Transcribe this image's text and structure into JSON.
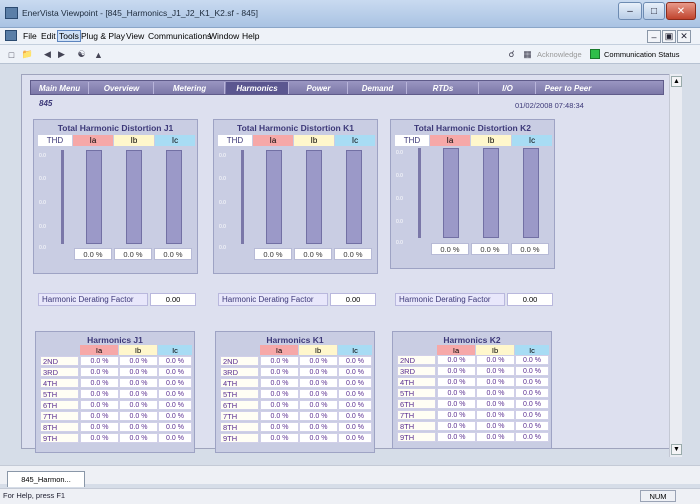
{
  "window": {
    "title": "EnerVista Viewpoint - [845_Harmonics_J1_J2_K1_K2.sf - 845]"
  },
  "menu": [
    "File",
    "Edit",
    "Tools",
    "Plug & Play",
    "View",
    "Communications",
    "Window",
    "Help"
  ],
  "toolbar": {
    "acknowledge": "Acknowledge",
    "comm_status": "Communication Status"
  },
  "nav": [
    "Main Menu",
    "Overview",
    "Metering",
    "Harmonics",
    "Power",
    "Demand",
    "RTDs",
    "I/O",
    "Peer to Peer"
  ],
  "device": "845",
  "datetime": "01/02/2008 07:48:34",
  "thd_panels": [
    {
      "title": "Total Harmonic Distortion J1",
      "thd": "THD",
      "ia": "Ia",
      "ib": "Ib",
      "ic": "Ic",
      "values": [
        "0.0 %",
        "0.0 %",
        "0.0 %"
      ],
      "tick_label": "0.0"
    },
    {
      "title": "Total Harmonic Distortion K1",
      "thd": "THD",
      "ia": "Ia",
      "ib": "Ib",
      "ic": "Ic",
      "values": [
        "0.0 %",
        "0.0 %",
        "0.0 %"
      ],
      "tick_label": "0.0"
    },
    {
      "title": "Total Harmonic Distortion K2",
      "thd": "THD",
      "ia": "Ia",
      "ib": "Ib",
      "ic": "Ic",
      "values": [
        "0.0 %",
        "0.0 %",
        "0.0 %"
      ],
      "tick_label": "0.0"
    }
  ],
  "derating": [
    {
      "label": "Harmonic Derating Factor",
      "value": "0.00"
    },
    {
      "label": "Harmonic Derating Factor",
      "value": "0.00"
    },
    {
      "label": "Harmonic Derating Factor",
      "value": "0.00"
    }
  ],
  "harmonic_tables": [
    {
      "title": "Harmonics J1",
      "cols": [
        "Ia",
        "Ib",
        "Ic"
      ],
      "rows": [
        {
          "label": "2ND",
          "values": [
            "0.0 %",
            "0.0 %",
            "0.0 %"
          ]
        },
        {
          "label": "3RD",
          "values": [
            "0.0 %",
            "0.0 %",
            "0.0 %"
          ]
        },
        {
          "label": "4TH",
          "values": [
            "0.0 %",
            "0.0 %",
            "0.0 %"
          ]
        },
        {
          "label": "5TH",
          "values": [
            "0.0 %",
            "0.0 %",
            "0.0 %"
          ]
        },
        {
          "label": "6TH",
          "values": [
            "0.0 %",
            "0.0 %",
            "0.0 %"
          ]
        },
        {
          "label": "7TH",
          "values": [
            "0.0 %",
            "0.0 %",
            "0.0 %"
          ]
        },
        {
          "label": "8TH",
          "values": [
            "0.0 %",
            "0.0 %",
            "0.0 %"
          ]
        },
        {
          "label": "9TH",
          "values": [
            "0.0 %",
            "0.0 %",
            "0.0 %"
          ]
        }
      ]
    },
    {
      "title": "Harmonics K1",
      "cols": [
        "Ia",
        "Ib",
        "Ic"
      ],
      "rows": [
        {
          "label": "2ND",
          "values": [
            "0.0 %",
            "0.0 %",
            "0.0 %"
          ]
        },
        {
          "label": "3RD",
          "values": [
            "0.0 %",
            "0.0 %",
            "0.0 %"
          ]
        },
        {
          "label": "4TH",
          "values": [
            "0.0 %",
            "0.0 %",
            "0.0 %"
          ]
        },
        {
          "label": "5TH",
          "values": [
            "0.0 %",
            "0.0 %",
            "0.0 %"
          ]
        },
        {
          "label": "6TH",
          "values": [
            "0.0 %",
            "0.0 %",
            "0.0 %"
          ]
        },
        {
          "label": "7TH",
          "values": [
            "0.0 %",
            "0.0 %",
            "0.0 %"
          ]
        },
        {
          "label": "8TH",
          "values": [
            "0.0 %",
            "0.0 %",
            "0.0 %"
          ]
        },
        {
          "label": "9TH",
          "values": [
            "0.0 %",
            "0.0 %",
            "0.0 %"
          ]
        }
      ]
    },
    {
      "title": "Harmonics K2",
      "cols": [
        "Ia",
        "Ib",
        "Ic"
      ],
      "rows": [
        {
          "label": "2ND",
          "values": [
            "0.0 %",
            "0.0 %",
            "0.0 %"
          ]
        },
        {
          "label": "3RD",
          "values": [
            "0.0 %",
            "0.0 %",
            "0.0 %"
          ]
        },
        {
          "label": "4TH",
          "values": [
            "0.0 %",
            "0.0 %",
            "0.0 %"
          ]
        },
        {
          "label": "5TH",
          "values": [
            "0.0 %",
            "0.0 %",
            "0.0 %"
          ]
        },
        {
          "label": "6TH",
          "values": [
            "0.0 %",
            "0.0 %",
            "0.0 %"
          ]
        },
        {
          "label": "7TH",
          "values": [
            "0.0 %",
            "0.0 %",
            "0.0 %"
          ]
        },
        {
          "label": "8TH",
          "values": [
            "0.0 %",
            "0.0 %",
            "0.0 %"
          ]
        },
        {
          "label": "9TH",
          "values": [
            "0.0 %",
            "0.0 %",
            "0.0 %"
          ]
        }
      ]
    }
  ],
  "doc_tab": "845_Harmon...",
  "status": {
    "text": "For Help, press F1",
    "num": "NUM"
  }
}
